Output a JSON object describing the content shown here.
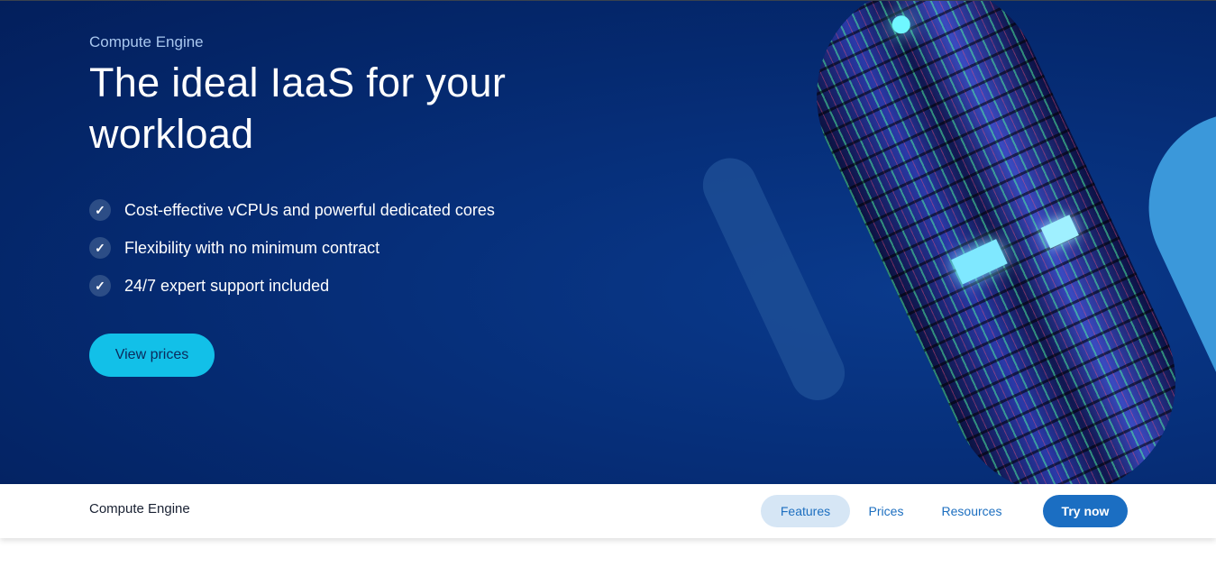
{
  "hero": {
    "eyebrow": "Compute Engine",
    "title": "The ideal IaaS for your workload",
    "features": [
      "Cost-effective vCPUs and powerful dedicated cores",
      "Flexibility with no minimum contract",
      "24/7 expert support included"
    ],
    "check_icon": "✓",
    "cta_label": "View prices"
  },
  "subnav": {
    "title": "Compute Engine",
    "items": [
      "Features",
      "Prices",
      "Resources"
    ],
    "active_item": "Features",
    "cta_label": "Try now"
  },
  "colors": {
    "hero_bg": "#062f7a",
    "accent_cyan": "#12c0e8",
    "brand_blue": "#1b6ec2",
    "active_tab_bg": "#d6e6f5"
  }
}
